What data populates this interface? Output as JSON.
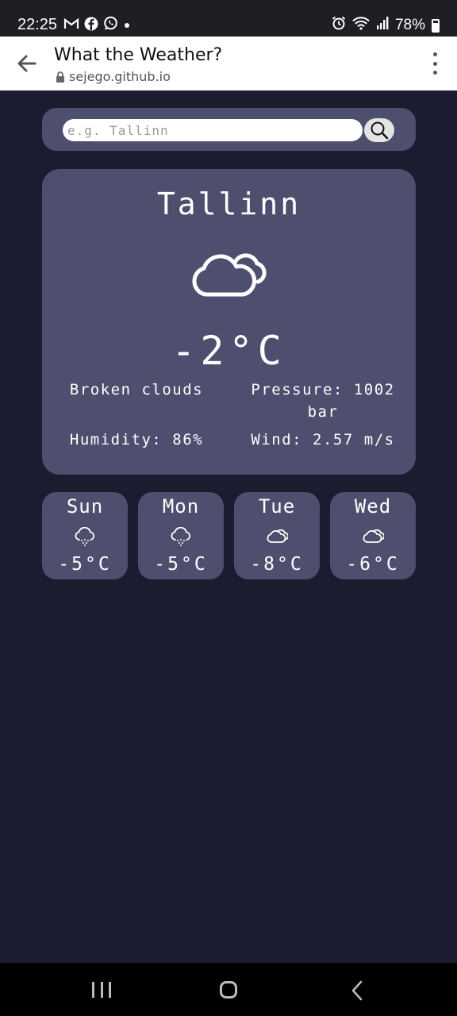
{
  "status_bar": {
    "time": "22:25",
    "left_icons": [
      "gmail-icon",
      "facebook-icon",
      "whatsapp-icon",
      "dot-icon"
    ],
    "right_icons": [
      "alarm-icon",
      "wifi-icon",
      "signal-icon"
    ],
    "battery": "78%"
  },
  "browser": {
    "title": "What the Weather?",
    "url": "sejego.github.io"
  },
  "search": {
    "placeholder": "e.g. Tallinn",
    "value": ""
  },
  "current": {
    "city": "Tallinn",
    "icon": "cloud-icon",
    "temperature": "-2°C",
    "description": "Broken clouds",
    "pressure": "Pressure: 1002 bar",
    "humidity": "Humidity: 86%",
    "wind": "Wind: 2.57 m/s"
  },
  "forecast": [
    {
      "day": "Sun",
      "icon": "snow-icon",
      "temp": "-5°C"
    },
    {
      "day": "Mon",
      "icon": "snow-icon",
      "temp": "-5°C"
    },
    {
      "day": "Tue",
      "icon": "cloud-icon",
      "temp": "-8°C"
    },
    {
      "day": "Wed",
      "icon": "cloud-icon",
      "temp": "-6°C"
    }
  ],
  "colors": {
    "background": "#1c1c30",
    "card": "#4e4e6e",
    "text": "#ffffff"
  }
}
